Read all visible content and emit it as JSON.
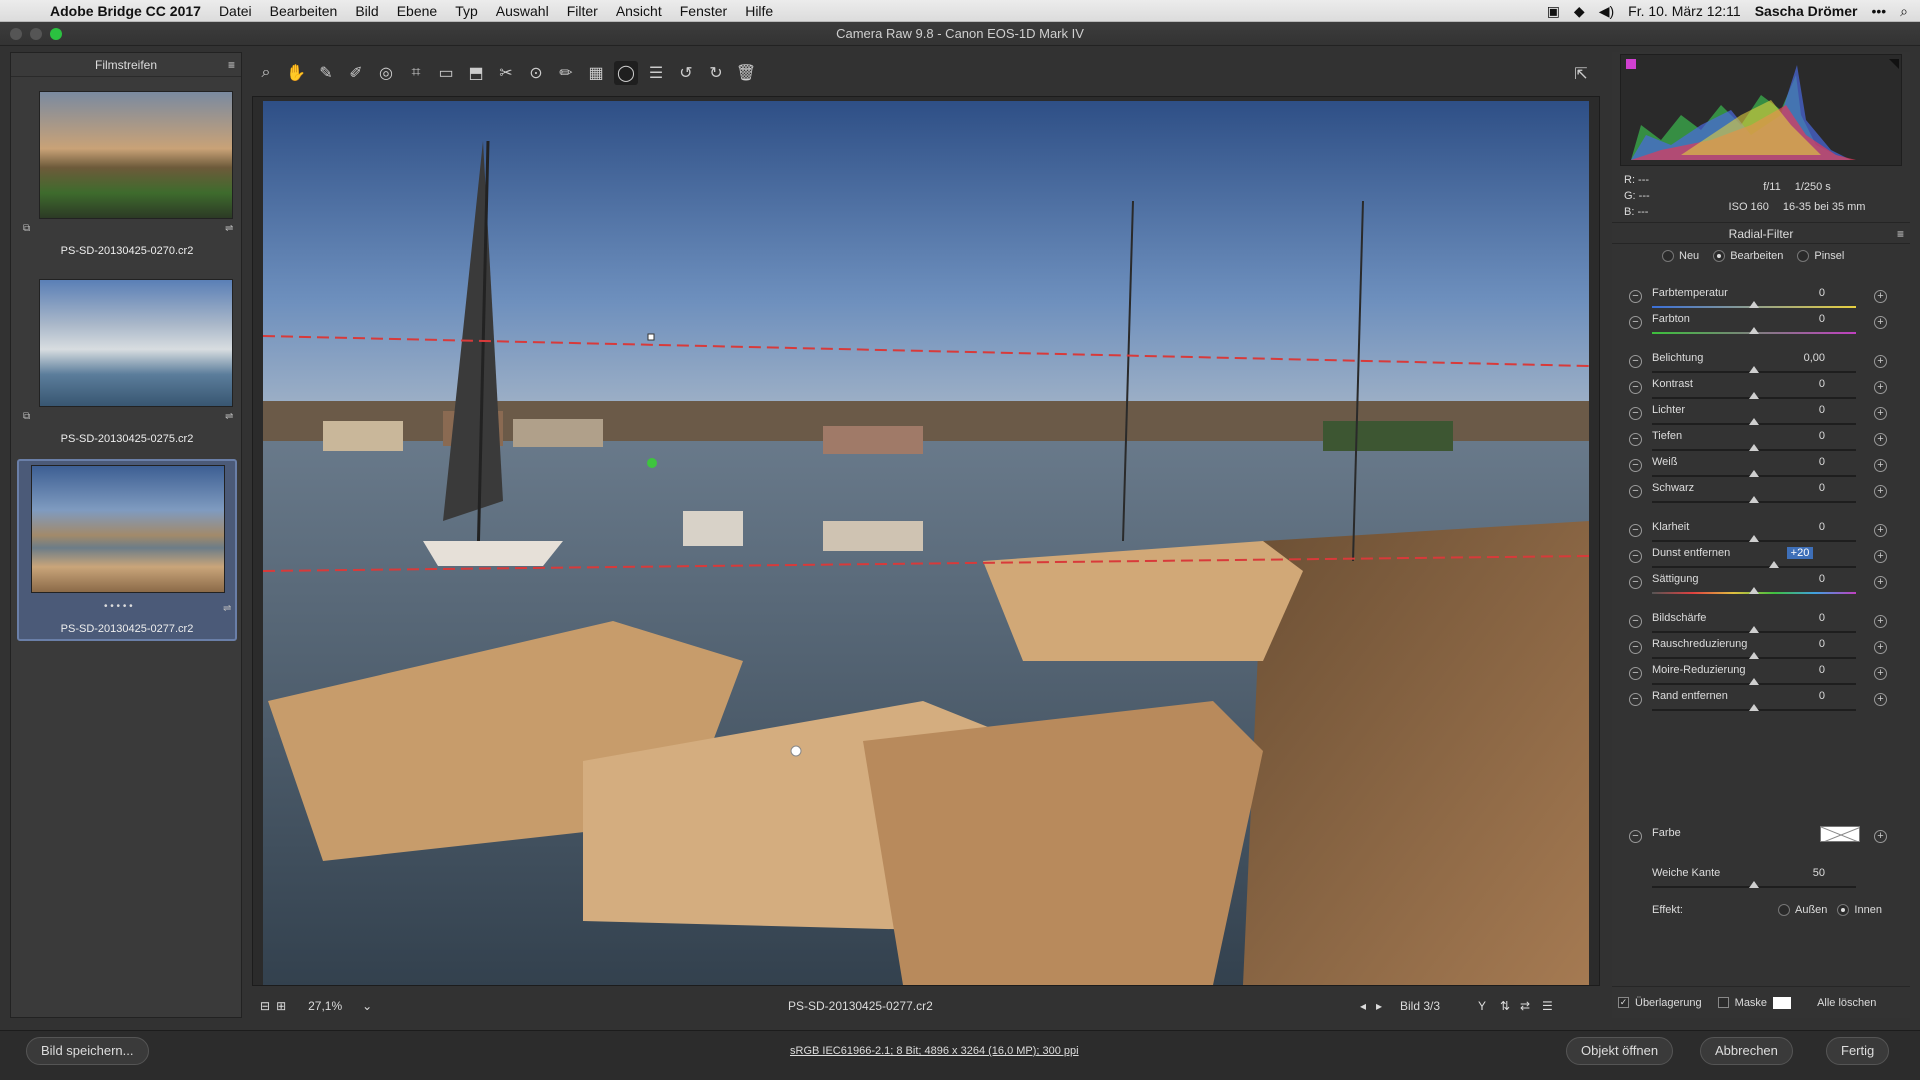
{
  "menubar": {
    "app": "Adobe Bridge CC 2017",
    "items": [
      "Datei",
      "Bearbeiten",
      "Bild",
      "Ebene",
      "Typ",
      "Auswahl",
      "Filter",
      "Ansicht",
      "Fenster",
      "Hilfe"
    ],
    "clock": "Fr. 10. März 12:11",
    "user": "Sascha Drömer"
  },
  "window": {
    "title": "Camera Raw 9.8 - Canon EOS-1D Mark IV"
  },
  "filmstrip": {
    "title": "Filmstreifen",
    "items": [
      {
        "name": "PS-SD-20130425-0270.cr2"
      },
      {
        "name": "PS-SD-20130425-0275.cr2"
      },
      {
        "name": "PS-SD-20130425-0277.cr2",
        "rating": "• • • • •"
      }
    ]
  },
  "status": {
    "zoom": "27,1%",
    "filename": "PS-SD-20130425-0277.cr2",
    "image_counter": "Bild 3/3"
  },
  "info": {
    "r": "R:   ---",
    "g": "G:   ---",
    "b": "B:   ---",
    "aperture": "f/11",
    "shutter": "1/250 s",
    "iso": "ISO 160",
    "lens": "16-35 bei 35 mm"
  },
  "panel": {
    "title": "Radial-Filter",
    "mode_new": "Neu",
    "mode_edit": "Bearbeiten",
    "mode_brush": "Pinsel",
    "sliders": [
      {
        "label": "Farbtemperatur",
        "value": "0",
        "pos": 0.5
      },
      {
        "label": "Farbton",
        "value": "0",
        "pos": 0.5
      },
      {
        "label": "Belichtung",
        "value": "0,00",
        "pos": 0.5
      },
      {
        "label": "Kontrast",
        "value": "0",
        "pos": 0.5
      },
      {
        "label": "Lichter",
        "value": "0",
        "pos": 0.5
      },
      {
        "label": "Tiefen",
        "value": "0",
        "pos": 0.5
      },
      {
        "label": "Weiß",
        "value": "0",
        "pos": 0.5
      },
      {
        "label": "Schwarz",
        "value": "0",
        "pos": 0.5
      },
      {
        "label": "Klarheit",
        "value": "0",
        "pos": 0.5
      },
      {
        "label": "Dunst entfernen",
        "value": "+20",
        "pos": 0.6
      },
      {
        "label": "Sättigung",
        "value": "0",
        "pos": 0.5
      },
      {
        "label": "Bildschärfe",
        "value": "0",
        "pos": 0.5
      },
      {
        "label": "Rauschreduzierung",
        "value": "0",
        "pos": 0.5
      },
      {
        "label": "Moire-Reduzierung",
        "value": "0",
        "pos": 0.5
      },
      {
        "label": "Rand entfernen",
        "value": "0",
        "pos": 0.5
      }
    ],
    "color_label": "Farbe",
    "feather_label": "Weiche Kante",
    "feather_value": "50",
    "feather_pos": 0.5,
    "effect_label": "Effekt:",
    "effect_outside": "Außen",
    "effect_inside": "Innen",
    "overlay_label": "Überlagerung",
    "mask_label": "Maske",
    "clear_all": "Alle löschen"
  },
  "bottom": {
    "save": "Bild speichern...",
    "workflow": "sRGB IEC61966-2.1; 8 Bit; 4896 x 3264 (16,0 MP); 300 ppi",
    "open": "Objekt öffnen",
    "cancel": "Abbrechen",
    "done": "Fertig"
  }
}
